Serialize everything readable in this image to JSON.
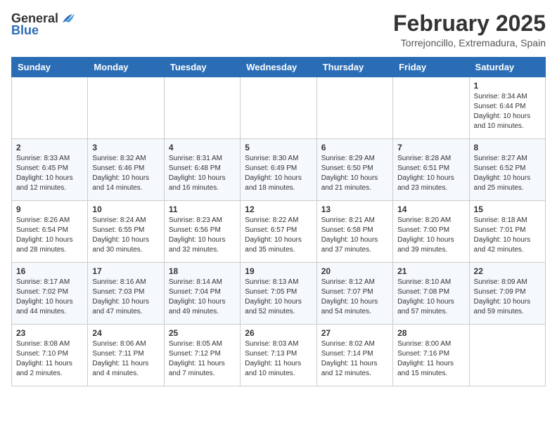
{
  "logo": {
    "text_general": "General",
    "text_blue": "Blue"
  },
  "title": {
    "month_year": "February 2025",
    "location": "Torrejoncillo, Extremadura, Spain"
  },
  "weekdays": [
    "Sunday",
    "Monday",
    "Tuesday",
    "Wednesday",
    "Thursday",
    "Friday",
    "Saturday"
  ],
  "weeks": [
    [
      {
        "day": "",
        "info": ""
      },
      {
        "day": "",
        "info": ""
      },
      {
        "day": "",
        "info": ""
      },
      {
        "day": "",
        "info": ""
      },
      {
        "day": "",
        "info": ""
      },
      {
        "day": "",
        "info": ""
      },
      {
        "day": "1",
        "info": "Sunrise: 8:34 AM\nSunset: 6:44 PM\nDaylight: 10 hours and 10 minutes."
      }
    ],
    [
      {
        "day": "2",
        "info": "Sunrise: 8:33 AM\nSunset: 6:45 PM\nDaylight: 10 hours and 12 minutes."
      },
      {
        "day": "3",
        "info": "Sunrise: 8:32 AM\nSunset: 6:46 PM\nDaylight: 10 hours and 14 minutes."
      },
      {
        "day": "4",
        "info": "Sunrise: 8:31 AM\nSunset: 6:48 PM\nDaylight: 10 hours and 16 minutes."
      },
      {
        "day": "5",
        "info": "Sunrise: 8:30 AM\nSunset: 6:49 PM\nDaylight: 10 hours and 18 minutes."
      },
      {
        "day": "6",
        "info": "Sunrise: 8:29 AM\nSunset: 6:50 PM\nDaylight: 10 hours and 21 minutes."
      },
      {
        "day": "7",
        "info": "Sunrise: 8:28 AM\nSunset: 6:51 PM\nDaylight: 10 hours and 23 minutes."
      },
      {
        "day": "8",
        "info": "Sunrise: 8:27 AM\nSunset: 6:52 PM\nDaylight: 10 hours and 25 minutes."
      }
    ],
    [
      {
        "day": "9",
        "info": "Sunrise: 8:26 AM\nSunset: 6:54 PM\nDaylight: 10 hours and 28 minutes."
      },
      {
        "day": "10",
        "info": "Sunrise: 8:24 AM\nSunset: 6:55 PM\nDaylight: 10 hours and 30 minutes."
      },
      {
        "day": "11",
        "info": "Sunrise: 8:23 AM\nSunset: 6:56 PM\nDaylight: 10 hours and 32 minutes."
      },
      {
        "day": "12",
        "info": "Sunrise: 8:22 AM\nSunset: 6:57 PM\nDaylight: 10 hours and 35 minutes."
      },
      {
        "day": "13",
        "info": "Sunrise: 8:21 AM\nSunset: 6:58 PM\nDaylight: 10 hours and 37 minutes."
      },
      {
        "day": "14",
        "info": "Sunrise: 8:20 AM\nSunset: 7:00 PM\nDaylight: 10 hours and 39 minutes."
      },
      {
        "day": "15",
        "info": "Sunrise: 8:18 AM\nSunset: 7:01 PM\nDaylight: 10 hours and 42 minutes."
      }
    ],
    [
      {
        "day": "16",
        "info": "Sunrise: 8:17 AM\nSunset: 7:02 PM\nDaylight: 10 hours and 44 minutes."
      },
      {
        "day": "17",
        "info": "Sunrise: 8:16 AM\nSunset: 7:03 PM\nDaylight: 10 hours and 47 minutes."
      },
      {
        "day": "18",
        "info": "Sunrise: 8:14 AM\nSunset: 7:04 PM\nDaylight: 10 hours and 49 minutes."
      },
      {
        "day": "19",
        "info": "Sunrise: 8:13 AM\nSunset: 7:05 PM\nDaylight: 10 hours and 52 minutes."
      },
      {
        "day": "20",
        "info": "Sunrise: 8:12 AM\nSunset: 7:07 PM\nDaylight: 10 hours and 54 minutes."
      },
      {
        "day": "21",
        "info": "Sunrise: 8:10 AM\nSunset: 7:08 PM\nDaylight: 10 hours and 57 minutes."
      },
      {
        "day": "22",
        "info": "Sunrise: 8:09 AM\nSunset: 7:09 PM\nDaylight: 10 hours and 59 minutes."
      }
    ],
    [
      {
        "day": "23",
        "info": "Sunrise: 8:08 AM\nSunset: 7:10 PM\nDaylight: 11 hours and 2 minutes."
      },
      {
        "day": "24",
        "info": "Sunrise: 8:06 AM\nSunset: 7:11 PM\nDaylight: 11 hours and 4 minutes."
      },
      {
        "day": "25",
        "info": "Sunrise: 8:05 AM\nSunset: 7:12 PM\nDaylight: 11 hours and 7 minutes."
      },
      {
        "day": "26",
        "info": "Sunrise: 8:03 AM\nSunset: 7:13 PM\nDaylight: 11 hours and 10 minutes."
      },
      {
        "day": "27",
        "info": "Sunrise: 8:02 AM\nSunset: 7:14 PM\nDaylight: 11 hours and 12 minutes."
      },
      {
        "day": "28",
        "info": "Sunrise: 8:00 AM\nSunset: 7:16 PM\nDaylight: 11 hours and 15 minutes."
      },
      {
        "day": "",
        "info": ""
      }
    ]
  ]
}
